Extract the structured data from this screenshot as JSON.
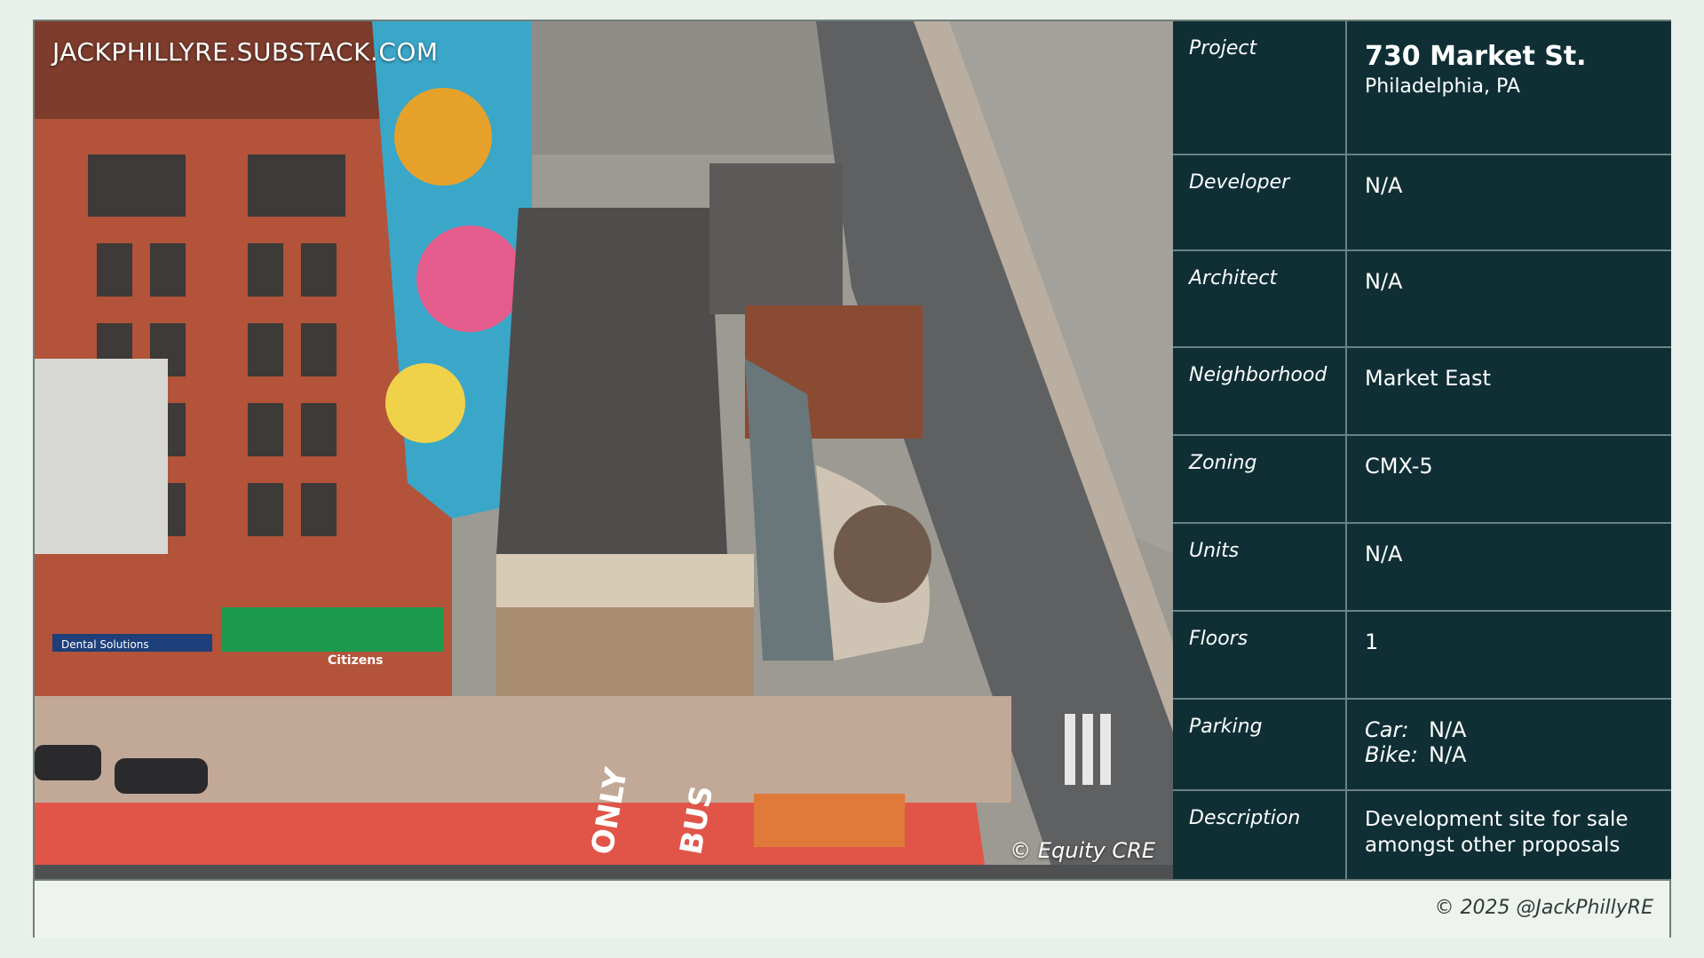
{
  "photo": {
    "watermark": "JACKPHILLYRE.SUBSTACK.COM",
    "credit": "© Equity CRE",
    "street_markings": [
      "ONLY",
      "BUS"
    ],
    "signs": [
      "Dental Solutions",
      "Citizens"
    ]
  },
  "info": {
    "project": {
      "label": "Project",
      "title": "730 Market St.",
      "subtitle": "Philadelphia, PA"
    },
    "developer": {
      "label": "Developer",
      "value": "N/A"
    },
    "architect": {
      "label": "Architect",
      "value": "N/A"
    },
    "neighborhood": {
      "label": "Neighborhood",
      "value": "Market East"
    },
    "zoning": {
      "label": "Zoning",
      "value": "CMX-5"
    },
    "units": {
      "label": "Units",
      "value": "N/A"
    },
    "floors": {
      "label": "Floors",
      "value": "1"
    },
    "parking": {
      "label": "Parking",
      "car_label": "Car:",
      "car_value": "N/A",
      "bike_label": "Bike:",
      "bike_value": "N/A"
    },
    "description": {
      "label": "Description",
      "value": "Development site for sale amongst other proposals"
    }
  },
  "footer": {
    "copyright": "© 2025 @JackPhillyRE"
  },
  "colors": {
    "panel": "#0f2f35",
    "background": "#e9f0ea",
    "divider": "#6d8184"
  }
}
